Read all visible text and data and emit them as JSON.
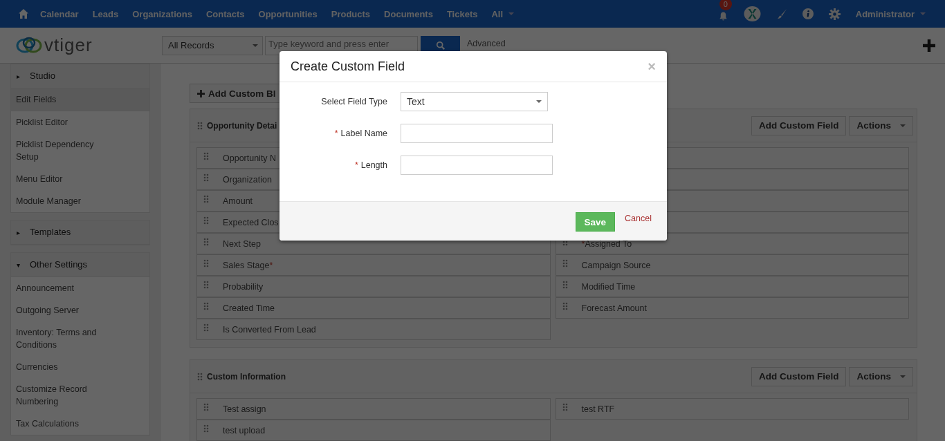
{
  "topnav": {
    "items": [
      "Calendar",
      "Leads",
      "Organizations",
      "Contacts",
      "Opportunities",
      "Products",
      "Documents",
      "Tickets",
      "All"
    ],
    "notifications": "0",
    "user": "Administrator"
  },
  "header": {
    "logo": "vtiger",
    "record_filter": "All Records",
    "search": {
      "placeholder": "Type keyword and press enter"
    },
    "advanced": "Advanced"
  },
  "sidebar": [
    {
      "label": "Studio",
      "arrow": "▸",
      "items": [
        {
          "label": "Edit Fields",
          "selected": true
        },
        {
          "label": "Picklist Editor",
          "selected": false
        },
        {
          "label": "Picklist Dependency Setup",
          "selected": false
        },
        {
          "label": "Menu Editor",
          "selected": false
        },
        {
          "label": "Module Manager",
          "selected": false
        }
      ]
    },
    {
      "label": "Templates",
      "arrow": "▸"
    },
    {
      "label": "Other Settings",
      "arrow": "▾",
      "items": [
        {
          "label": "Announcement",
          "selected": false
        },
        {
          "label": "Outgoing Server",
          "selected": false
        },
        {
          "label": "Inventory: Terms and Conditions",
          "selected": false
        },
        {
          "label": "Currencies",
          "selected": false
        },
        {
          "label": "Customize Record Numbering",
          "selected": false
        },
        {
          "label": "Tax Calculations",
          "selected": false
        }
      ]
    }
  ],
  "add_block": "Add Custom Bl",
  "blocks": [
    {
      "title": "Opportunity Detai",
      "add_field": "Add Custom Field",
      "actions": "Actions",
      "left": [
        {
          "kind": "field",
          "label": "Opportunity N"
        },
        {
          "kind": "field",
          "label": "Organization"
        },
        {
          "kind": "field",
          "label": "Amount"
        },
        {
          "kind": "field",
          "label": "Expected Clos"
        },
        {
          "kind": "field",
          "label": "Next Step"
        },
        {
          "kind": "field",
          "label": "Sales Stage",
          "mark_after": "*"
        },
        {
          "kind": "field",
          "label": "Probability"
        },
        {
          "kind": "field",
          "label": "Created Time"
        },
        {
          "kind": "field",
          "label": "Is Converted From Lead"
        }
      ],
      "right": [
        {
          "kind": "covered"
        },
        {
          "kind": "covered"
        },
        {
          "kind": "covered"
        },
        {
          "kind": "covered"
        },
        {
          "kind": "field",
          "label": "Assigned To",
          "mark_before": "*"
        },
        {
          "kind": "field",
          "label": "Campaign Source"
        },
        {
          "kind": "field",
          "label": "Modified Time"
        },
        {
          "kind": "field",
          "label": "Forecast Amount"
        }
      ]
    },
    {
      "title": "Custom Information",
      "add_field": "Add Custom Field",
      "actions": "Actions",
      "left": [
        {
          "kind": "field",
          "label": "Test assign"
        },
        {
          "kind": "field",
          "label": "test upload"
        }
      ],
      "right": [
        {
          "kind": "field",
          "label": "test RTF"
        }
      ]
    }
  ],
  "dialog": {
    "title": "Create Custom Field",
    "close": "×",
    "fields": [
      {
        "kind": "select",
        "label": "Select Field Type",
        "value": "Text"
      },
      {
        "kind": "input",
        "label": "Label Name",
        "mark": "*"
      },
      {
        "kind": "input",
        "label": "Length",
        "mark": "*"
      }
    ],
    "save": "Save",
    "cancel": "Cancel"
  }
}
